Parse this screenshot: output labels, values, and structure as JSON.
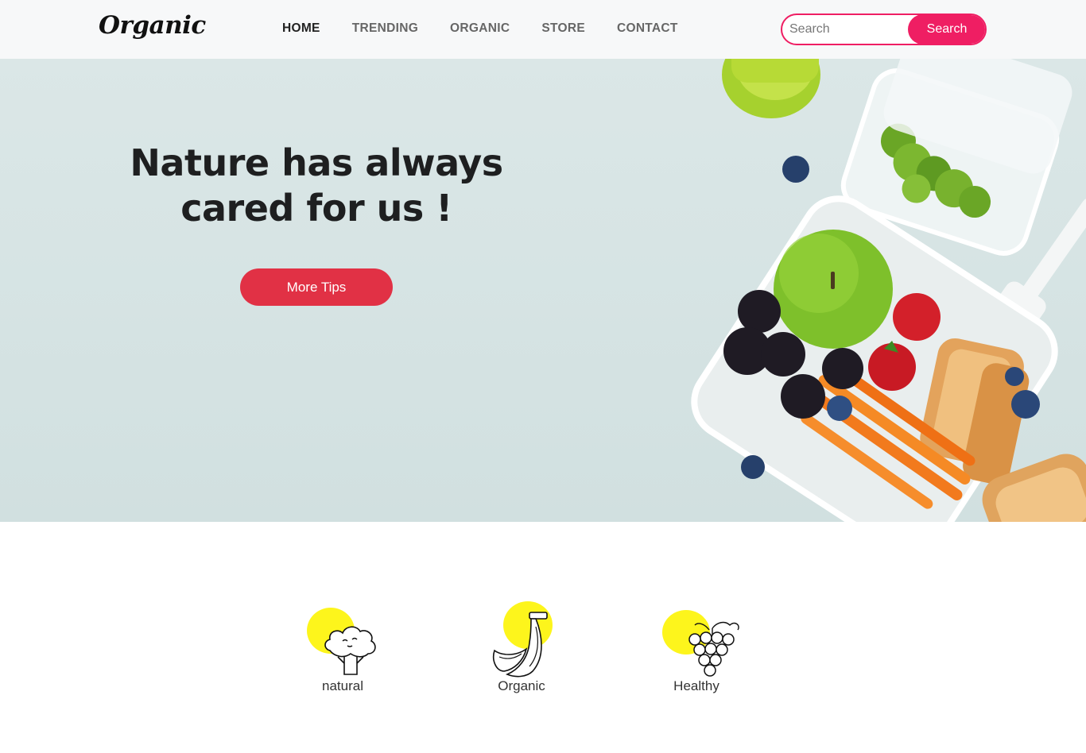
{
  "header": {
    "logo": "Organic",
    "nav": [
      {
        "label": "HOME",
        "active": true
      },
      {
        "label": "TRENDING",
        "active": false
      },
      {
        "label": "ORGANIC",
        "active": false
      },
      {
        "label": "STORE",
        "active": false
      },
      {
        "label": "CONTACT",
        "active": false
      }
    ],
    "search": {
      "placeholder": "Search",
      "value": "",
      "button_label": "Search"
    }
  },
  "hero": {
    "title_line1": "Nature has always",
    "title_line2": "cared for us !",
    "button_label": "More Tips"
  },
  "features": [
    {
      "label": "natural",
      "icon": "broccoli-icon"
    },
    {
      "label": "Organic",
      "icon": "banana-icon"
    },
    {
      "label": "Healthy",
      "icon": "grapes-icon"
    }
  ],
  "colors": {
    "accent": "#ef1e63",
    "hero_button": "#e13145",
    "hero_bg": "#d6e4e4",
    "feature_blob": "#fdf51c"
  }
}
